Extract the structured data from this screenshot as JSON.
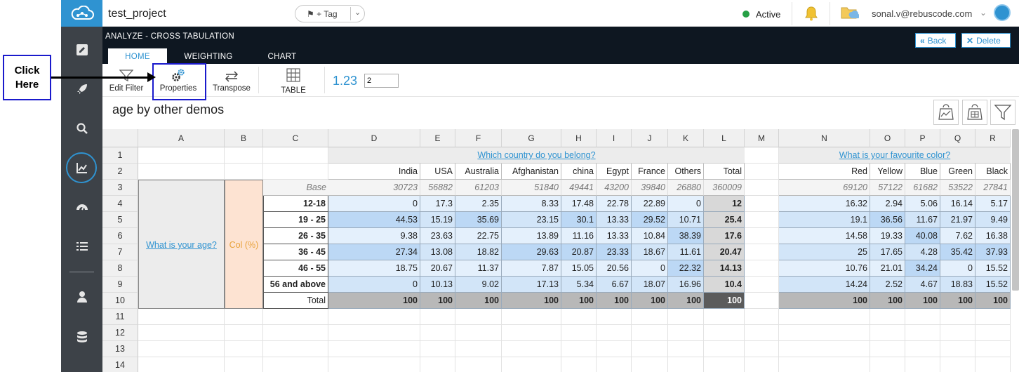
{
  "annotation": {
    "callout": "Click Here"
  },
  "topbar": {
    "project_name": "test_project",
    "tag_label": "+ Tag",
    "status": "Active",
    "user_email": "sonal.v@rebuscode.com",
    "status_color": "#26a045",
    "accent_color": "#2f93d1"
  },
  "header": {
    "section_title": "ANALYZE - CROSS TABULATION",
    "tabs": [
      "HOME",
      "WEIGHTING",
      "CHART"
    ],
    "active_tab": "HOME",
    "back_label": "Back",
    "delete_label": "Delete"
  },
  "toolbar": {
    "tools": [
      "Edit Filter",
      "Properties",
      "Transpose",
      "TABLE"
    ],
    "decimal_display": "1.23",
    "decimal_value": "2"
  },
  "page": {
    "title": "age by other demos"
  },
  "grid": {
    "columns": [
      "A",
      "B",
      "C",
      "D",
      "E",
      "F",
      "G",
      "H",
      "I",
      "J",
      "K",
      "L",
      "M",
      "N",
      "O",
      "P",
      "Q",
      "R"
    ],
    "rows": [
      "1",
      "2",
      "3",
      "4",
      "5",
      "6",
      "7",
      "8",
      "9",
      "10",
      "11",
      "12",
      "13",
      "14"
    ],
    "banner1_question": "Which country do you belong?",
    "banner2_question": "What is your favourite color?",
    "row_question": "What is your age?",
    "row_stat": "Col (%)",
    "base_label": "Base",
    "banner1_headers": [
      "India",
      "USA",
      "Australia",
      "Afghanistan",
      "china",
      "Egypt",
      "France",
      "Others",
      "Total"
    ],
    "banner2_headers": [
      "Red",
      "Yellow",
      "Blue",
      "Green",
      "Black"
    ],
    "base1": [
      "30723",
      "56882",
      "61203",
      "51840",
      "49441",
      "43200",
      "39840",
      "26880",
      "360009"
    ],
    "base2": [
      "69120",
      "57122",
      "61682",
      "53522",
      "27841"
    ],
    "row_labels": [
      "12-18",
      "19 - 25",
      "26 - 35",
      "36 - 45",
      "46 - 55",
      "56 and above",
      "Total"
    ],
    "values1": [
      [
        "0",
        "17.3",
        "2.35",
        "8.33",
        "17.48",
        "22.78",
        "22.89",
        "0",
        "12"
      ],
      [
        "44.53",
        "15.19",
        "35.69",
        "23.15",
        "30.1",
        "13.33",
        "29.52",
        "10.71",
        "25.4"
      ],
      [
        "9.38",
        "23.63",
        "22.75",
        "13.89",
        "11.16",
        "13.33",
        "10.84",
        "38.39",
        "17.6"
      ],
      [
        "27.34",
        "13.08",
        "18.82",
        "29.63",
        "20.87",
        "23.33",
        "18.67",
        "11.61",
        "20.47"
      ],
      [
        "18.75",
        "20.67",
        "11.37",
        "7.87",
        "15.05",
        "20.56",
        "0",
        "22.32",
        "14.13"
      ],
      [
        "0",
        "10.13",
        "9.02",
        "17.13",
        "5.34",
        "6.67",
        "18.07",
        "16.96",
        "10.4"
      ],
      [
        "100",
        "100",
        "100",
        "100",
        "100",
        "100",
        "100",
        "100",
        "100"
      ]
    ],
    "values2": [
      [
        "16.32",
        "2.94",
        "5.06",
        "16.14",
        "5.17"
      ],
      [
        "19.1",
        "36.56",
        "11.67",
        "21.97",
        "9.49"
      ],
      [
        "14.58",
        "19.33",
        "40.08",
        "7.62",
        "16.38"
      ],
      [
        "25",
        "17.65",
        "4.28",
        "35.42",
        "37.93"
      ],
      [
        "10.76",
        "21.01",
        "34.24",
        "0",
        "15.52"
      ],
      [
        "14.24",
        "2.52",
        "4.67",
        "18.83",
        "15.52"
      ],
      [
        "100",
        "100",
        "100",
        "100",
        "100"
      ]
    ]
  }
}
